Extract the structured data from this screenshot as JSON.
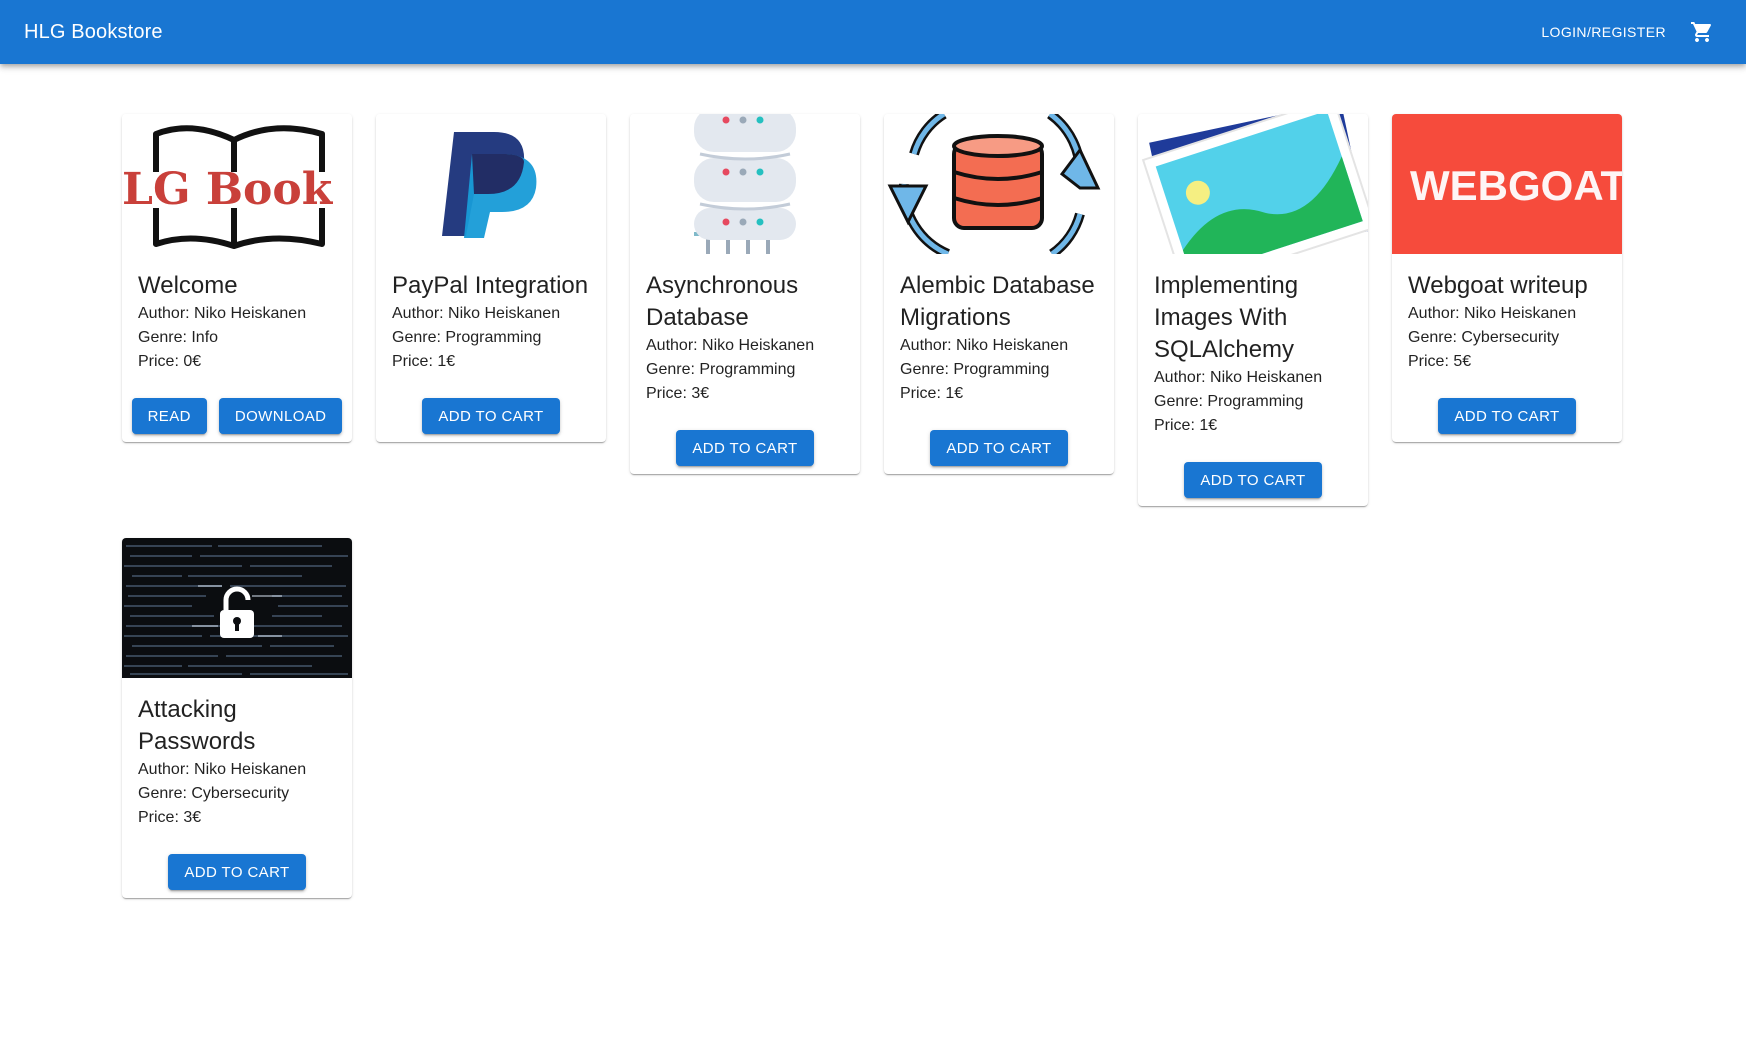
{
  "appbar": {
    "title": "HLG Bookstore",
    "login_label": "LOGIN/REGISTER",
    "cart_icon": "shopping-cart-icon",
    "color": "#1976d2"
  },
  "accent_color": "#1976d2",
  "books": [
    {
      "title": "Welcome",
      "author": "Author: Niko Heiskanen",
      "genre": "Genre: Info",
      "price": "Price: 0€",
      "image": "hlg-book-logo",
      "logo_text": "LG Book",
      "actions": [
        "READ",
        "DOWNLOAD"
      ]
    },
    {
      "title": "PayPal Integration",
      "author": "Author: Niko Heiskanen",
      "genre": "Genre: Programming",
      "price": "Price: 1€",
      "image": "paypal-logo",
      "actions": [
        "ADD TO CART"
      ]
    },
    {
      "title": "Asynchronous Database",
      "author": "Author: Niko Heiskanen",
      "genre": "Genre: Programming",
      "price": "Price: 3€",
      "image": "database-server-illustration",
      "actions": [
        "ADD TO CART"
      ]
    },
    {
      "title": "Alembic Database Migrations",
      "author": "Author: Niko Heiskanen",
      "genre": "Genre: Programming",
      "price": "Price: 1€",
      "image": "database-sync-illustration",
      "actions": [
        "ADD TO CART"
      ]
    },
    {
      "title": "Implementing Images With SQLAlchemy",
      "author": "Author: Niko Heiskanen",
      "genre": "Genre: Programming",
      "price": "Price: 1€",
      "image": "photo-illustration",
      "actions": [
        "ADD TO CART"
      ]
    },
    {
      "title": "Webgoat writeup",
      "author": "Author: Niko Heiskanen",
      "genre": "Genre: Cybersecurity",
      "price": "Price: 5€",
      "image": "webgoat-logo",
      "logo_text": "WEBGOAT",
      "actions": [
        "ADD TO CART"
      ]
    },
    {
      "title": "Attacking Passwords",
      "author": "Author: Niko Heiskanen",
      "genre": "Genre: Cybersecurity",
      "price": "Price: 3€",
      "image": "code-padlock-image",
      "actions": [
        "ADD TO CART"
      ]
    }
  ]
}
